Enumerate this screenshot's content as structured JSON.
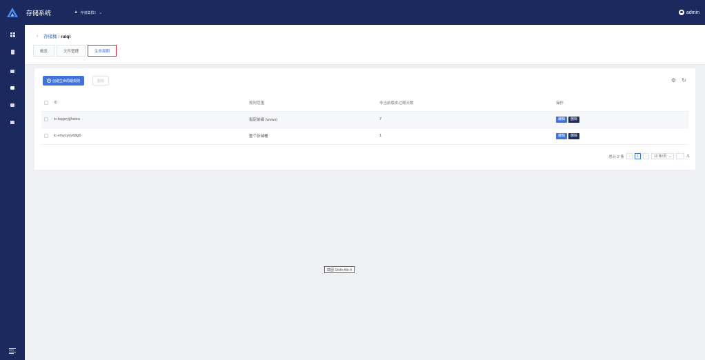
{
  "app": {
    "title": "存储系统",
    "cluster": "存储集群1",
    "user": "admin"
  },
  "breadcrumb": {
    "parent": "存储桶",
    "separator": "/",
    "current": "rulql"
  },
  "tabs": [
    "概览",
    "文件管理",
    "生命周期"
  ],
  "toolbar": {
    "create_label": "创建生命周期规则",
    "delete_label": "删除"
  },
  "table": {
    "headers": [
      "ID",
      "规则范围",
      "非当前版本过期天数",
      "操作"
    ],
    "rows": [
      {
        "id": "lc-tcjqpryjjhstea",
        "scope": "指定前缀 (wuwu)",
        "days": "7",
        "edit": "编辑",
        "delete": "删除"
      },
      {
        "id": "lc-vmycyrjv68g6",
        "scope": "整个存储桶",
        "days": "1",
        "edit": "编辑",
        "delete": "删除"
      }
    ]
  },
  "pagination": {
    "total": "总计 2 条",
    "current_page": "1",
    "page_size": "10 条/页",
    "total_pages": "/1"
  },
  "tooltip": "截图 Shift+Alt+A",
  "colors": {
    "nav": "#1b2a5e",
    "primary": "#3f73db",
    "highlight": "#d4242f"
  }
}
